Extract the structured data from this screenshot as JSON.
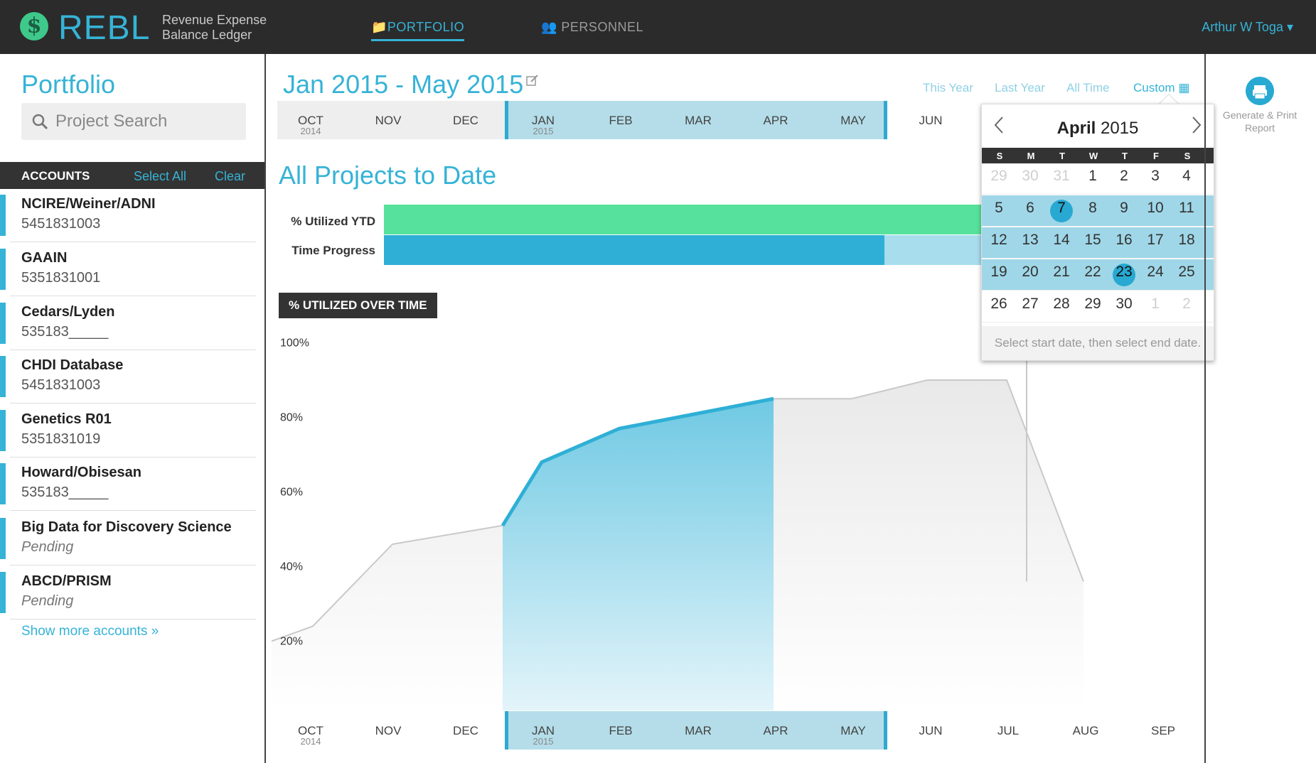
{
  "header": {
    "logo_mark": "$",
    "logo": "REBL",
    "sub1": "Revenue Expense",
    "sub2": "Balance Ledger",
    "nav": {
      "portfolio": "PORTFOLIO",
      "personnel": "PERSONNEL"
    },
    "user": "Arthur W Toga"
  },
  "sidebar": {
    "title": "Portfolio",
    "search_placeholder": "Project Search",
    "accounts_label": "ACCOUNTS",
    "select_all": "Select All",
    "clear": "Clear",
    "accounts": [
      {
        "name": "NCIRE/Weiner/ADNI",
        "number": "5451831003"
      },
      {
        "name": "GAAIN",
        "number": "5351831001"
      },
      {
        "name": "Cedars/Lyden",
        "number": "535183_____"
      },
      {
        "name": "CHDI Database",
        "number": "5451831003"
      },
      {
        "name": "Genetics R01",
        "number": "5351831019"
      },
      {
        "name": "Howard/Obisesan",
        "number": "535183_____"
      },
      {
        "name": "Big Data for Discovery Science",
        "number": "Pending"
      },
      {
        "name": "ABCD/PRISM",
        "number": "Pending"
      }
    ],
    "show_more": "Show more accounts"
  },
  "main": {
    "range_title": "Jan 2015 - May 2015",
    "quick": {
      "this_year": "This Year",
      "last_year": "Last Year",
      "all_time": "All Time",
      "custom": "Custom"
    },
    "timeline": [
      {
        "m": "OCT",
        "y": "2014"
      },
      {
        "m": "NOV",
        "y": ""
      },
      {
        "m": "DEC",
        "y": ""
      },
      {
        "m": "JAN",
        "y": "2015"
      },
      {
        "m": "FEB",
        "y": ""
      },
      {
        "m": "MAR",
        "y": ""
      },
      {
        "m": "APR",
        "y": ""
      },
      {
        "m": "MAY",
        "y": ""
      },
      {
        "m": "JUN",
        "y": ""
      }
    ],
    "timeline_bottom": [
      {
        "m": "OCT",
        "y": "2014"
      },
      {
        "m": "NOV",
        "y": ""
      },
      {
        "m": "DEC",
        "y": ""
      },
      {
        "m": "JAN",
        "y": "2015"
      },
      {
        "m": "FEB",
        "y": ""
      },
      {
        "m": "MAR",
        "y": ""
      },
      {
        "m": "APR",
        "y": ""
      },
      {
        "m": "MAY",
        "y": ""
      },
      {
        "m": "JUN",
        "y": ""
      },
      {
        "m": "JUL",
        "y": ""
      },
      {
        "m": "AUG",
        "y": ""
      },
      {
        "m": "SEP",
        "y": ""
      }
    ],
    "all_projects": "All Projects to Date",
    "util_label": "% Utilized YTD",
    "time_label": "Time Progress",
    "util_badge": "% UTILIZED OVER TIME"
  },
  "calendar": {
    "month": "April",
    "year": "2015",
    "dow": [
      "S",
      "M",
      "T",
      "W",
      "T",
      "F",
      "S"
    ],
    "weeks": [
      [
        "29",
        "30",
        "31",
        "1",
        "2",
        "3",
        "4"
      ],
      [
        "5",
        "6",
        "7",
        "8",
        "9",
        "10",
        "11"
      ],
      [
        "12",
        "13",
        "14",
        "15",
        "16",
        "17",
        "18"
      ],
      [
        "19",
        "20",
        "21",
        "22",
        "23",
        "24",
        "25"
      ],
      [
        "26",
        "27",
        "28",
        "29",
        "30",
        "1",
        "2"
      ]
    ],
    "footer": "Select start date, then select end date."
  },
  "right": {
    "print_label": "Generate & Print Report"
  },
  "chart_data": {
    "type": "area",
    "title": "% UTILIZED OVER TIME",
    "categories": [
      "OCT 2014",
      "NOV",
      "DEC",
      "JAN 2015",
      "FEB",
      "MAR",
      "APR",
      "MAY",
      "JUN",
      "JUL",
      "AUG",
      "SEP"
    ],
    "yticks": [
      "100%",
      "80%",
      "60%",
      "40%",
      "20%"
    ],
    "ylim": [
      10,
      100
    ],
    "series": [
      {
        "values": [
          20,
          24,
          46,
          51,
          68,
          77,
          81,
          85,
          85,
          90,
          90,
          36
        ]
      }
    ],
    "selected_range": [
      "JAN 2015",
      "MAY"
    ]
  }
}
